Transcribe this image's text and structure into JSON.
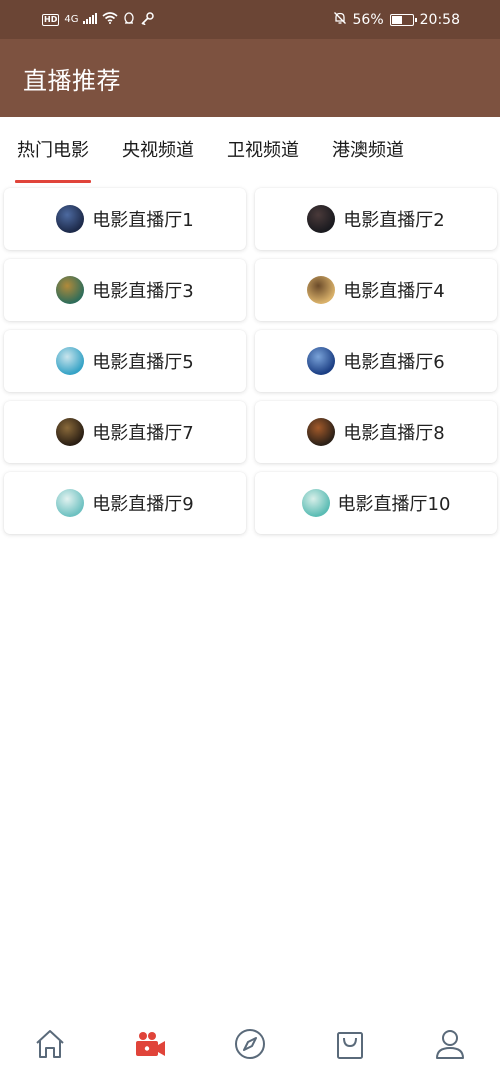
{
  "status_bar": {
    "hd": "HD",
    "network": "4G",
    "battery_percent": "56%",
    "battery_level": 0.56,
    "time": "20:58"
  },
  "header": {
    "title": "直播推荐"
  },
  "tabs": [
    {
      "label": "热门电影",
      "active": true
    },
    {
      "label": "央视频道",
      "active": false
    },
    {
      "label": "卫视频道",
      "active": false
    },
    {
      "label": "港澳频道",
      "active": false
    }
  ],
  "rooms": [
    {
      "label": "电影直播厅1",
      "avatar_colors": [
        "#1d2a4a",
        "#4d6aa0"
      ]
    },
    {
      "label": "电影直播厅2",
      "avatar_colors": [
        "#1a1a1f",
        "#4a3a3a"
      ]
    },
    {
      "label": "电影直播厅3",
      "avatar_colors": [
        "#2f6d5a",
        "#b28a3a"
      ]
    },
    {
      "label": "电影直播厅4",
      "avatar_colors": [
        "#d9b16a",
        "#6b4b2a"
      ]
    },
    {
      "label": "电影直播厅5",
      "avatar_colors": [
        "#36a3c6",
        "#c9e4ec"
      ]
    },
    {
      "label": "电影直播厅6",
      "avatar_colors": [
        "#1c3f84",
        "#7aa3d9"
      ]
    },
    {
      "label": "电影直播厅7",
      "avatar_colors": [
        "#2b1f14",
        "#8a6a3a"
      ]
    },
    {
      "label": "电影直播厅8",
      "avatar_colors": [
        "#2c2118",
        "#a35a2a"
      ]
    },
    {
      "label": "电影直播厅9",
      "avatar_colors": [
        "#6ec1c1",
        "#e2f2f0"
      ]
    },
    {
      "label": "电影直播厅10",
      "avatar_colors": [
        "#5bbcb4",
        "#d8efe9"
      ]
    }
  ],
  "bottom_nav": [
    {
      "icon": "home-icon",
      "active": false
    },
    {
      "icon": "video-camera-icon",
      "active": true
    },
    {
      "icon": "compass-icon",
      "active": false
    },
    {
      "icon": "shopping-bag-icon",
      "active": false
    },
    {
      "icon": "profile-icon",
      "active": false
    }
  ],
  "colors": {
    "header_bg": "#7d5240",
    "status_bg": "#6b4535",
    "accent": "#e0443a",
    "nav_inactive": "#5a6a7a"
  }
}
